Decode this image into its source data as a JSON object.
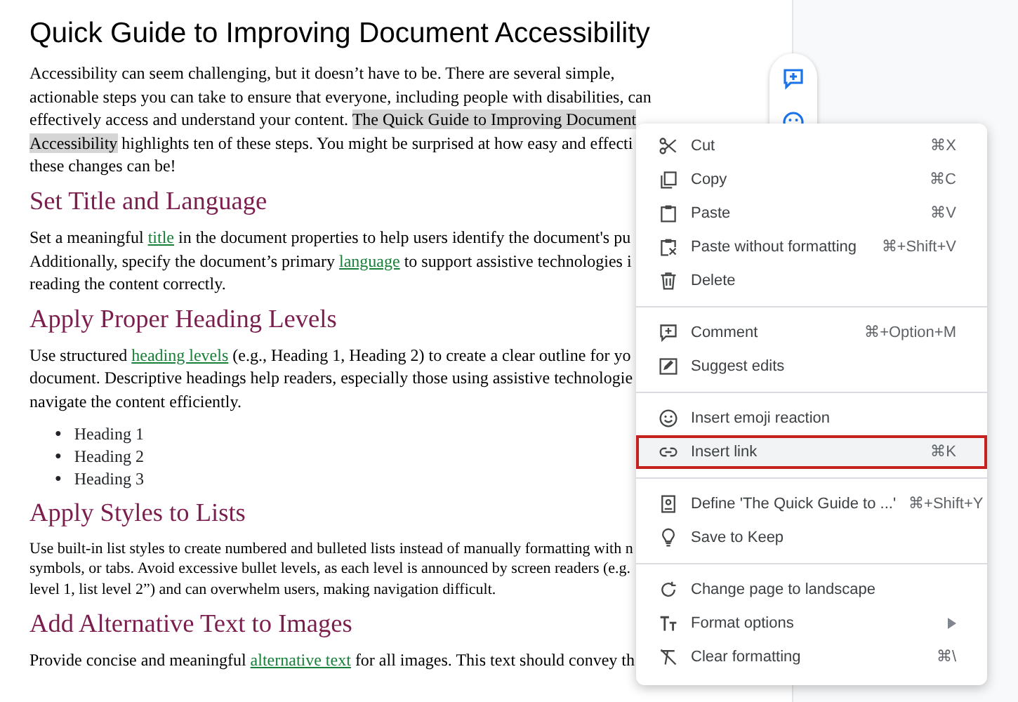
{
  "document": {
    "title": "Quick Guide to Improving Document Accessibility",
    "blocks": [
      {
        "kind": "paragraph",
        "lines": [
          [
            {
              "kind": "text",
              "text": "Accessibility can seem challenging, but it doesn’t have to be. There are several simple,"
            }
          ],
          [
            {
              "kind": "text",
              "text": "actionable steps you can take to ensure that everyone, including people with disabilities, can"
            }
          ],
          [
            {
              "kind": "text",
              "text": "effectively access and understand your content. "
            },
            {
              "kind": "highlight",
              "text": "The Quick Guide to Improving Document"
            }
          ],
          [
            {
              "kind": "highlight",
              "text": "Accessibility"
            },
            {
              "kind": "text",
              "text": " highlights ten of these steps. You might be surprised at how easy and effecti"
            }
          ],
          [
            {
              "kind": "text",
              "text": "these changes can be!"
            }
          ]
        ]
      },
      {
        "kind": "heading",
        "text": "Set Title and Language"
      },
      {
        "kind": "paragraph",
        "lines": [
          [
            {
              "kind": "text",
              "text": "Set a meaningful "
            },
            {
              "kind": "link",
              "text": "title"
            },
            {
              "kind": "text",
              "text": " in the document properties to help users identify the document's pu"
            }
          ],
          [
            {
              "kind": "text",
              "text": "Additionally, specify the document’s primary "
            },
            {
              "kind": "link",
              "text": "language"
            },
            {
              "kind": "text",
              "text": " to support assistive technologies i"
            }
          ],
          [
            {
              "kind": "text",
              "text": "reading the content correctly."
            }
          ]
        ]
      },
      {
        "kind": "heading",
        "text": "Apply Proper Heading Levels"
      },
      {
        "kind": "paragraph",
        "lines": [
          [
            {
              "kind": "text",
              "text": "Use structured "
            },
            {
              "kind": "link",
              "text": "heading levels"
            },
            {
              "kind": "text",
              "text": " (e.g., Heading 1, Heading 2) to create a clear outline for yo"
            }
          ],
          [
            {
              "kind": "text",
              "text": "document. Descriptive headings help readers, especially those using assistive technologie"
            }
          ],
          [
            {
              "kind": "text",
              "text": "navigate the content efficiently."
            }
          ]
        ]
      },
      {
        "kind": "bullets",
        "items": [
          {
            "marker": "●",
            "text": "Heading 1"
          },
          {
            "marker": "●",
            "text": "Heading 2"
          },
          {
            "marker": "●",
            "text": "Heading 3"
          }
        ]
      },
      {
        "kind": "heading",
        "text": "Apply Styles to Lists"
      },
      {
        "kind": "small_paragraph",
        "lines": [
          [
            {
              "kind": "text",
              "text": "Use built-in list styles to create numbered and bulleted lists instead of manually formatting with n"
            }
          ],
          [
            {
              "kind": "text",
              "text": "symbols, or tabs. Avoid excessive bullet levels, as each level is announced by screen readers (e.g."
            }
          ],
          [
            {
              "kind": "text",
              "text": "level 1, list level 2”) and can overwhelm users, making navigation difficult."
            }
          ]
        ]
      },
      {
        "kind": "heading",
        "text": "Add Alternative Text to Images"
      },
      {
        "kind": "paragraph",
        "lines": [
          [
            {
              "kind": "text",
              "text": "Provide concise and meaningful "
            },
            {
              "kind": "link",
              "text": "alternative text"
            },
            {
              "kind": "text",
              "text": " for all images. This text should convey th"
            }
          ]
        ]
      }
    ]
  },
  "context_menu": {
    "groups": [
      [
        {
          "label": "Cut",
          "shortcut": "⌘X",
          "selected": false,
          "submenu": false
        },
        {
          "label": "Copy",
          "shortcut": "⌘C",
          "selected": false,
          "submenu": false
        },
        {
          "label": "Paste",
          "shortcut": "⌘V",
          "selected": false,
          "submenu": false
        },
        {
          "label": "Paste without formatting",
          "shortcut": "⌘+Shift+V",
          "selected": false,
          "submenu": false
        },
        {
          "label": "Delete",
          "selected": false,
          "submenu": false
        }
      ],
      [
        {
          "label": "Comment",
          "shortcut": "⌘+Option+M",
          "selected": false,
          "submenu": false
        },
        {
          "label": "Suggest edits",
          "selected": false,
          "submenu": false
        }
      ],
      [
        {
          "label": "Insert emoji reaction",
          "selected": false,
          "submenu": false
        },
        {
          "label": "Insert link",
          "shortcut": "⌘K",
          "selected": true,
          "submenu": false
        }
      ],
      [
        {
          "label": "Define 'The Quick Guide to ...'",
          "shortcut": "⌘+Shift+Y",
          "selected": false,
          "submenu": false
        },
        {
          "label": "Save to Keep",
          "selected": false,
          "submenu": false
        }
      ],
      [
        {
          "label": "Change page to landscape",
          "selected": false,
          "submenu": false
        },
        {
          "label": "Format options",
          "selected": false,
          "submenu": true
        },
        {
          "label": "Clear formatting",
          "shortcut": "⌘\\",
          "selected": false,
          "submenu": false
        }
      ]
    ]
  }
}
